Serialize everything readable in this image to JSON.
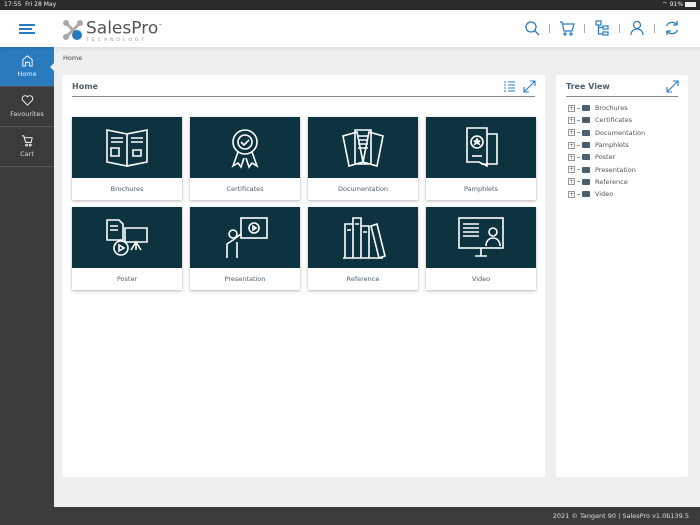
{
  "status": {
    "time": "17:55",
    "date": "Fri 28 May",
    "battery": "91%"
  },
  "header": {
    "brand": "SalesPro",
    "brand_sub": "TECHNOLOGY",
    "tm": "™"
  },
  "sidebar": {
    "items": [
      {
        "label": "Home",
        "icon": "home-icon"
      },
      {
        "label": "Favourites",
        "icon": "heart-icon"
      },
      {
        "label": "Cart",
        "icon": "cart-icon"
      }
    ]
  },
  "breadcrumb": "Home",
  "main": {
    "title": "Home",
    "tiles": [
      {
        "label": "Brochures"
      },
      {
        "label": "Certificates"
      },
      {
        "label": "Documentation"
      },
      {
        "label": "Pamphlets"
      },
      {
        "label": "Poster"
      },
      {
        "label": "Presentation"
      },
      {
        "label": "Reference"
      },
      {
        "label": "Video"
      }
    ]
  },
  "tree": {
    "title": "Tree View",
    "items": [
      "Brochures",
      "Certificates",
      "Documentation",
      "Pamphlets",
      "Poster",
      "Presentation",
      "Reference",
      "Video"
    ]
  },
  "footer": "2021 © Tangent 90 | SalesPro v1.0b139.5",
  "colors": {
    "accent": "#2a7bbd",
    "tile": "#0d3340",
    "sidebar": "#3b3b3b"
  }
}
